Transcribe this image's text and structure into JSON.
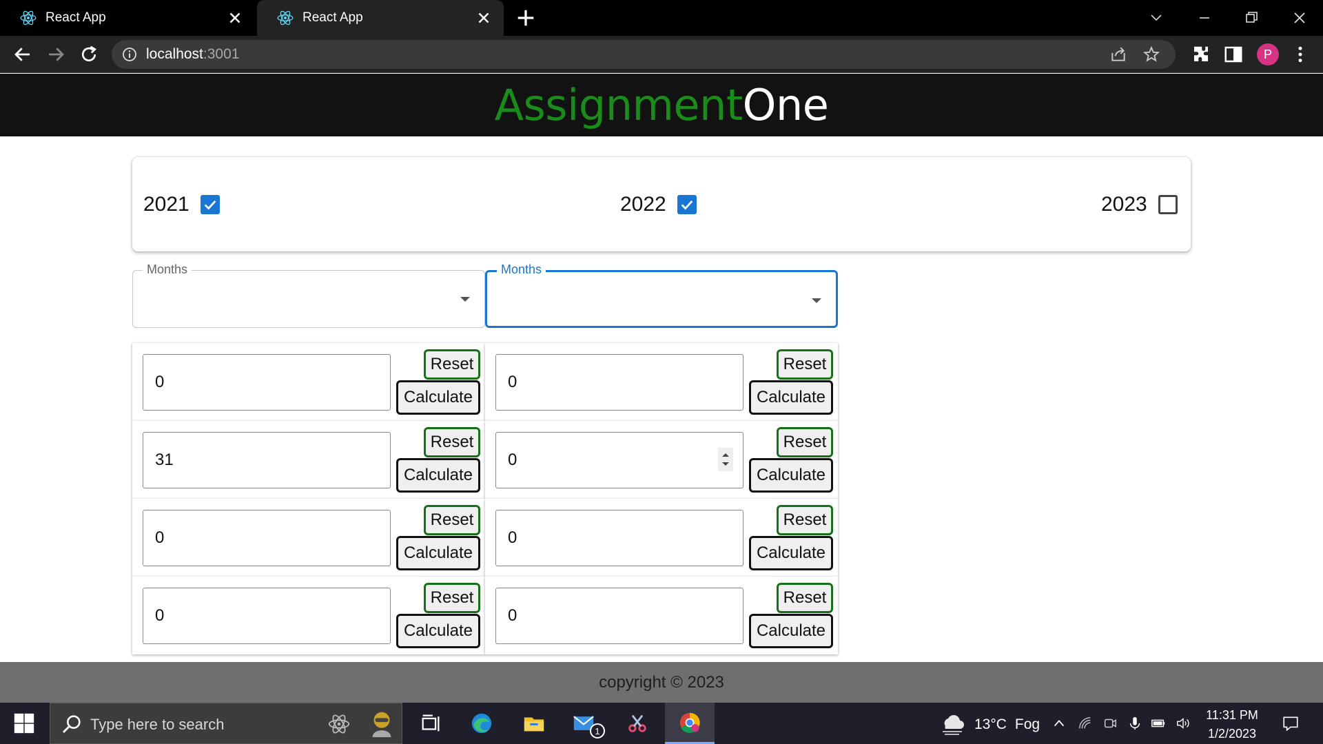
{
  "browser": {
    "tabs": [
      {
        "title": "React App"
      },
      {
        "title": "React App"
      }
    ],
    "address": {
      "host": "localhost",
      "port": ":3001"
    },
    "profile_initial": "P"
  },
  "app": {
    "title_green": "Assignment",
    "title_white": "One",
    "title_colors": {
      "green": "#1a8c1a",
      "white": "#ffffff"
    }
  },
  "years": [
    {
      "label": "2021",
      "checked": true
    },
    {
      "label": "2022",
      "checked": true
    },
    {
      "label": "2023",
      "checked": false
    }
  ],
  "month_selects": [
    {
      "label": "Months",
      "value": "",
      "focused": false
    },
    {
      "label": "Months",
      "value": "",
      "focused": true
    }
  ],
  "calculators": [
    {
      "value": "0",
      "reset_label": "Reset",
      "calc_label": "Calculate"
    },
    {
      "value": "0",
      "reset_label": "Reset",
      "calc_label": "Calculate"
    },
    {
      "value": "31",
      "reset_label": "Reset",
      "calc_label": "Calculate"
    },
    {
      "value": "0",
      "reset_label": "Reset",
      "calc_label": "Calculate"
    },
    {
      "value": "0",
      "reset_label": "Reset",
      "calc_label": "Calculate"
    },
    {
      "value": "0",
      "reset_label": "Reset",
      "calc_label": "Calculate"
    },
    {
      "value": "0",
      "reset_label": "Reset",
      "calc_label": "Calculate"
    },
    {
      "value": "0",
      "reset_label": "Reset",
      "calc_label": "Calculate"
    }
  ],
  "footer": {
    "text": "copyright © 2023"
  },
  "taskbar": {
    "search_placeholder": "Type here to search",
    "weather": {
      "temp": "13°C",
      "condition": "Fog"
    },
    "time": "11:31 PM",
    "date": "1/2/2023",
    "mail_badge": "1"
  },
  "colors": {
    "accent": "#1976d2",
    "reset_border": "#177017",
    "footer_bg": "#6f6f6f",
    "header_bg": "#121212"
  }
}
